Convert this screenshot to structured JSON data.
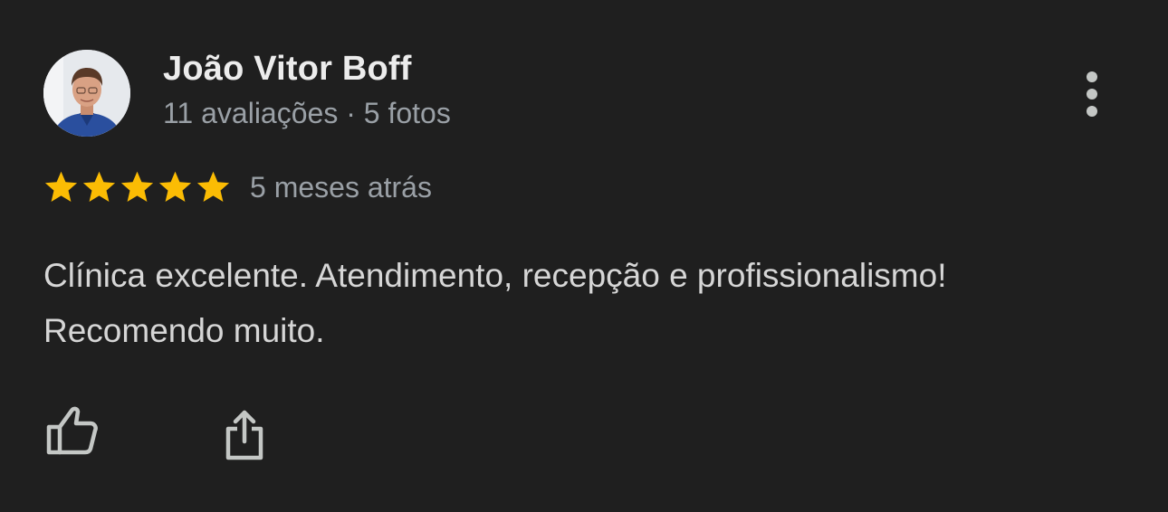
{
  "review": {
    "reviewer": {
      "name": "João Vitor Boff",
      "meta": "11 avaliações · 5 fotos",
      "avatar_icon": "user-photo"
    },
    "rating": {
      "stars": 5,
      "max_stars": 5,
      "star_color": "#fbbc04"
    },
    "date": "5 meses atrás",
    "text_lines": [
      "Clínica excelente. Atendimento, recepção e profissionalismo!",
      "Recomendo muito."
    ],
    "actions": {
      "like_icon": "thumbs-up-icon",
      "share_icon": "share-icon",
      "more_icon": "more-vertical-icon"
    }
  },
  "colors": {
    "background": "#1f1f1f",
    "name_text": "#ececec",
    "secondary_text": "#9aa0a6",
    "body_text": "#d6d6d6",
    "icon": "#c4c7c5"
  }
}
